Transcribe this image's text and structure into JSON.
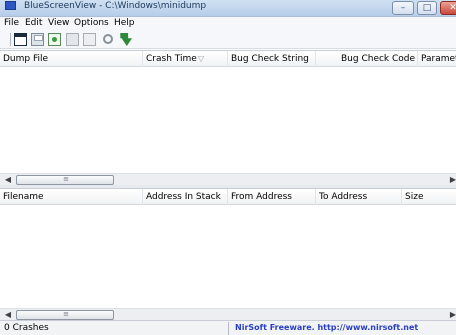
{
  "window": {
    "title": "BlueScreenView  -  C:\\Windows\\minidump"
  },
  "menu": [
    {
      "label": "File"
    },
    {
      "label": "Edit"
    },
    {
      "label": "View"
    },
    {
      "label": "Options"
    },
    {
      "label": "Help"
    }
  ],
  "toolbar": {
    "icons": [
      "window-icon",
      "save-icon",
      "html-report-icon",
      "copy-icon",
      "properties-icon",
      "find-icon",
      "exit-icon"
    ]
  },
  "upper_table": {
    "columns": [
      "Dump File",
      "Crash Time",
      "Bug Check String",
      "Bug Check Code",
      "Parameter"
    ],
    "sort_indicator": "▽",
    "rows": []
  },
  "lower_table": {
    "columns": [
      "Filename",
      "Address In Stack",
      "From Address",
      "To Address",
      "Size"
    ],
    "rows": []
  },
  "status": {
    "count": "0 Crashes",
    "link": "NirSoft Freeware.  http://www.nirsoft.net"
  }
}
